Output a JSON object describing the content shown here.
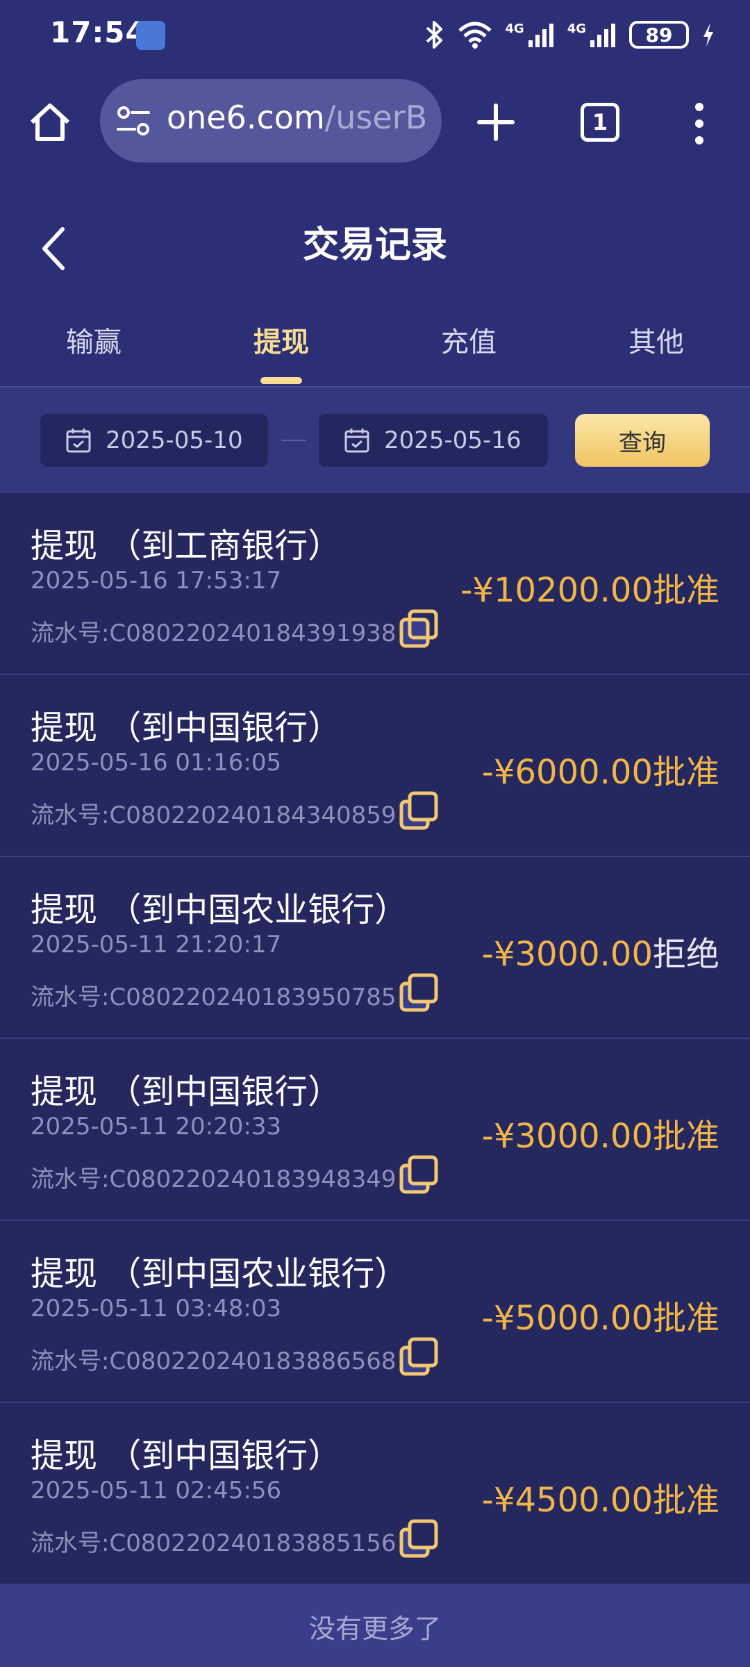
{
  "status_bar": {
    "time": "17:54",
    "net_label_1": "4G",
    "net_label_2": "4G",
    "battery": "89"
  },
  "browser": {
    "url_host": "one6.com",
    "url_path": "/userB",
    "tab_count": "1"
  },
  "header": {
    "title": "交易记录",
    "tabs": [
      {
        "label": "输赢"
      },
      {
        "label": "提现"
      },
      {
        "label": "充值"
      },
      {
        "label": "其他"
      }
    ],
    "active_tab": "提现"
  },
  "filter": {
    "start_date": "2025-05-10",
    "end_date": "2025-05-16",
    "query_label": "查询"
  },
  "records": [
    {
      "title": "提现 （到工商银行）",
      "time": "2025-05-16 17:53:17",
      "serial": "流水号:C080220240184391938",
      "amount": "-¥10200.00",
      "status": "批准"
    },
    {
      "title": "提现 （到中国银行）",
      "time": "2025-05-16 01:16:05",
      "serial": "流水号:C080220240184340859",
      "amount": "-¥6000.00",
      "status": "批准"
    },
    {
      "title": "提现 （到中国农业银行）",
      "time": "2025-05-11 21:20:17",
      "serial": "流水号:C080220240183950785",
      "amount": "-¥3000.00",
      "status": "拒绝"
    },
    {
      "title": "提现 （到中国银行）",
      "time": "2025-05-11 20:20:33",
      "serial": "流水号:C080220240183948349",
      "amount": "-¥3000.00",
      "status": "批准"
    },
    {
      "title": "提现 （到中国农业银行）",
      "time": "2025-05-11 03:48:03",
      "serial": "流水号:C080220240183886568",
      "amount": "-¥5000.00",
      "status": "批准"
    },
    {
      "title": "提现 （到中国银行）",
      "time": "2025-05-11 02:45:56",
      "serial": "流水号:C080220240183885156",
      "amount": "-¥4500.00",
      "status": "批准"
    }
  ],
  "footer": {
    "no_more_text": "没有更多了"
  },
  "colors": {
    "background": "#262a64",
    "accent_gold": "#f6dc95",
    "amount": "#f2b548"
  }
}
